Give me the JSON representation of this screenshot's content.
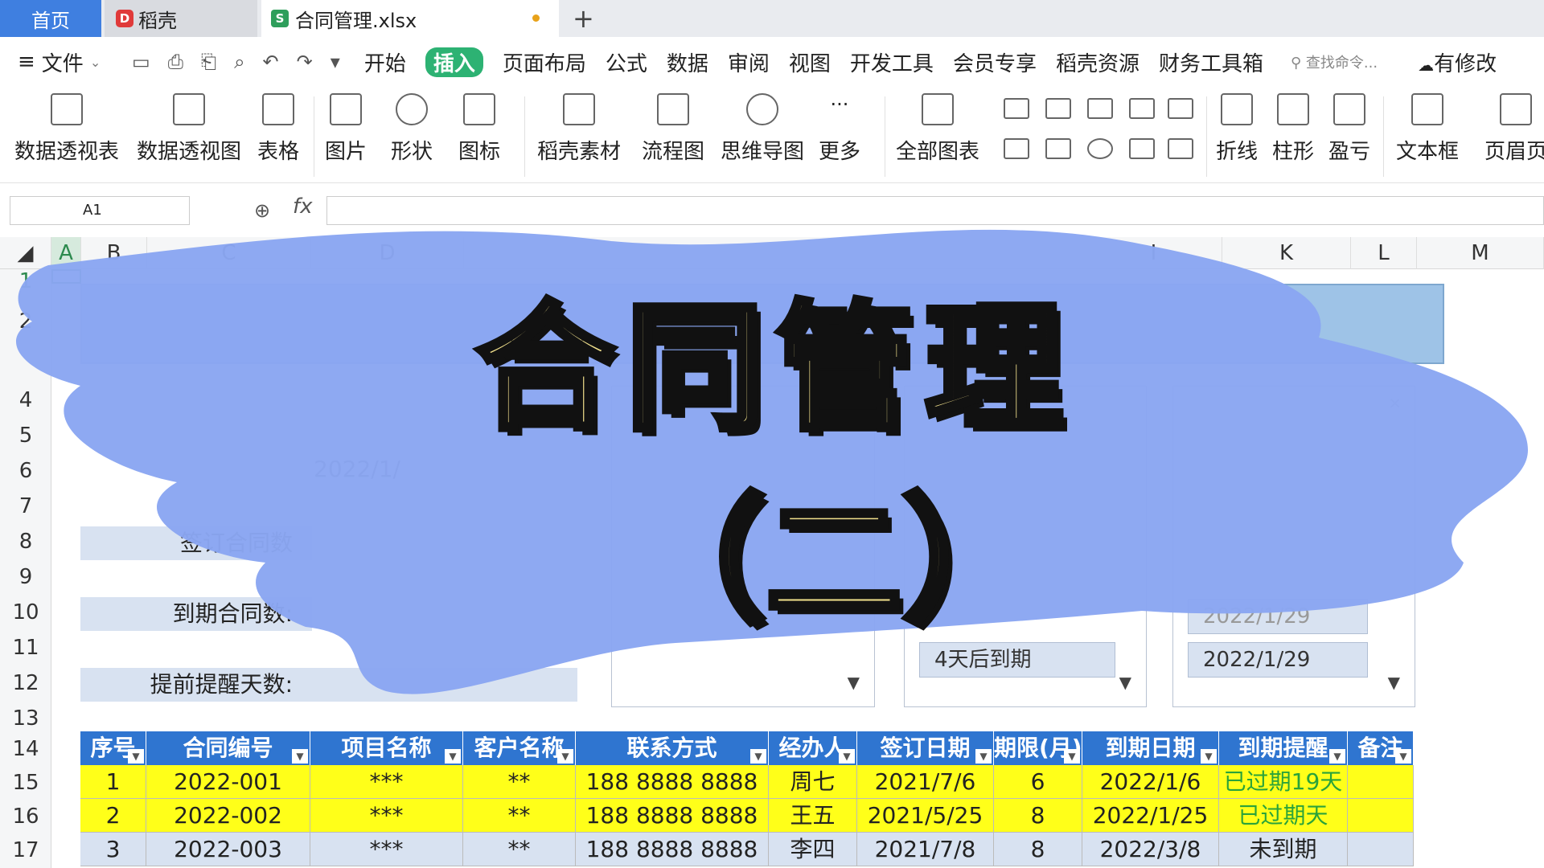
{
  "tabs": {
    "home": "首页",
    "daoke": "稻壳",
    "file": "合同管理.xlsx"
  },
  "menu": {
    "file": "文件",
    "items": [
      "开始",
      "插入",
      "页面布局",
      "公式",
      "数据",
      "审阅",
      "视图",
      "开发工具",
      "会员专享",
      "稻壳资源",
      "财务工具箱"
    ],
    "search": "查找命令...",
    "modified": "有修改"
  },
  "ribbon": {
    "pivot_table": "数据透视表",
    "pivot_chart": "数据透视图",
    "table": "表格",
    "picture": "图片",
    "shape": "形状",
    "icon": "图标",
    "material": "稻壳素材",
    "flowchart": "流程图",
    "mindmap": "思维导图",
    "more": "更多",
    "all_charts": "全部图表",
    "line": "折线",
    "column": "柱形",
    "winloss": "盈亏",
    "textbox": "文本框",
    "header_footer": "页眉页"
  },
  "formula": {
    "cell_ref": "A1",
    "fx": "fx"
  },
  "columns": [
    "A",
    "B",
    "C",
    "D",
    "I",
    "K",
    "L",
    "M"
  ],
  "rows": [
    "1",
    "2",
    "4",
    "5",
    "6",
    "7",
    "8",
    "9",
    "10",
    "11",
    "12",
    "13",
    "14",
    "15",
    "16",
    "17"
  ],
  "sheet": {
    "label_signed": "签订合同数",
    "label_expired": "到期合同数:",
    "label_remind": "提前提醒天数:",
    "date_partial": "2022/1/",
    "list_days": "4天后到期",
    "list_date_partial": "2022/1/29",
    "list_date": "2022/1/29"
  },
  "table": {
    "headers": [
      "序号",
      "合同编号",
      "项目名称",
      "客户名称",
      "联系方式",
      "经办人",
      "签订日期",
      "期限(月)",
      "到期日期",
      "到期提醒",
      "备注"
    ],
    "rows": [
      [
        "1",
        "2022-001",
        "***",
        "**",
        "188 8888 8888",
        "周七",
        "2021/7/6",
        "6",
        "2022/1/6",
        "已过期19天",
        ""
      ],
      [
        "2",
        "2022-002",
        "***",
        "**",
        "188 8888 8888",
        "王五",
        "2021/5/25",
        "8",
        "2022/1/25",
        "已过期天",
        ""
      ],
      [
        "3",
        "2022-003",
        "***",
        "**",
        "188 8888 8888",
        "李四",
        "2021/7/8",
        "8",
        "2022/3/8",
        "未到期",
        ""
      ]
    ]
  },
  "overlay": {
    "title": "合同管理",
    "subtitle": "（二）"
  },
  "colors": {
    "accent": "#2f75d0",
    "brush": "#8aa6f2",
    "title_fill": "#f3e28d",
    "active_menu": "#2db273"
  }
}
